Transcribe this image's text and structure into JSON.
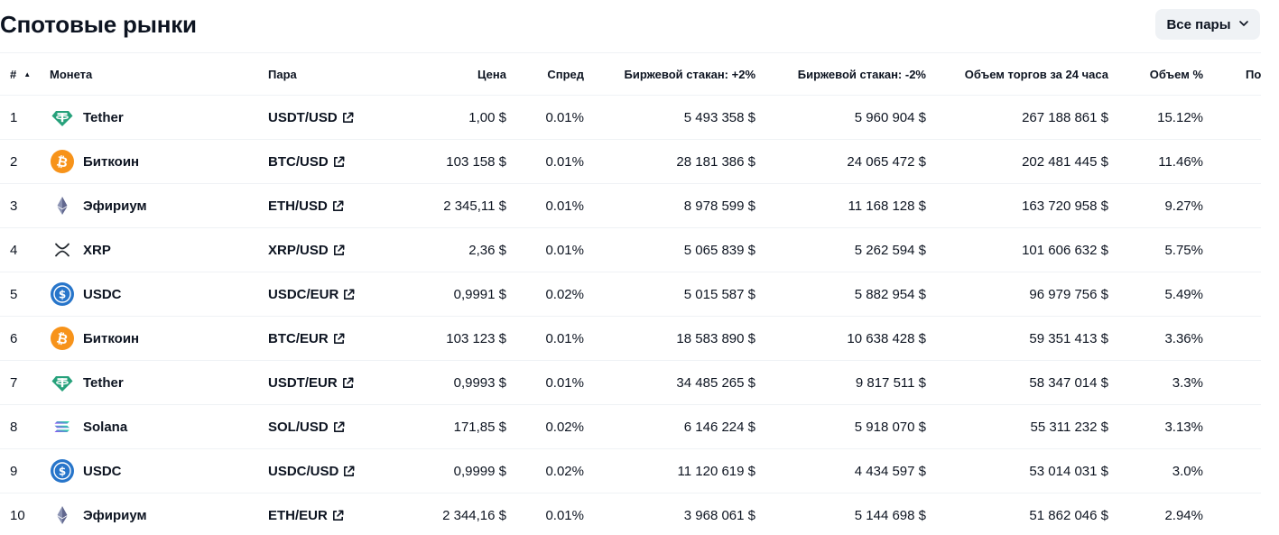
{
  "page": {
    "title": "Спотовые рынки",
    "filter_label": "Все пары"
  },
  "colors": {
    "text": "#0d1421",
    "divider": "#eff2f5",
    "tether": "#26a17b",
    "bitcoin": "#f7931a",
    "usdc": "#2775ca",
    "ethereum": "#627eea"
  },
  "table": {
    "headers": {
      "rank": "#",
      "coin": "Монета",
      "pair": "Пара",
      "price": "Цена",
      "spread": "Спред",
      "depth_plus": "Биржевой стакан: +2%",
      "depth_minus": "Биржевой стакан: -2%",
      "volume_24h": "Объем торгов за 24 часа",
      "volume_pct": "Объем %",
      "last_updated": "Последнее обновление"
    },
    "rows": [
      {
        "rank": "1",
        "coin": "Tether",
        "icon": "tether-icon",
        "pair": "USDT/USD",
        "price": "1,00 $",
        "spread": "0.01%",
        "depth_plus": "5 493 358 $",
        "depth_minus": "5 960 904 $",
        "volume": "267 188 861 $",
        "volume_pct": "15.12%"
      },
      {
        "rank": "2",
        "coin": "Биткоин",
        "icon": "bitcoin-icon",
        "pair": "BTC/USD",
        "price": "103 158 $",
        "spread": "0.01%",
        "depth_plus": "28 181 386 $",
        "depth_minus": "24 065 472 $",
        "volume": "202 481 445 $",
        "volume_pct": "11.46%"
      },
      {
        "rank": "3",
        "coin": "Эфириум",
        "icon": "ethereum-icon",
        "pair": "ETH/USD",
        "price": "2 345,11 $",
        "spread": "0.01%",
        "depth_plus": "8 978 599 $",
        "depth_minus": "11 168 128 $",
        "volume": "163 720 958 $",
        "volume_pct": "9.27%"
      },
      {
        "rank": "4",
        "coin": "XRP",
        "icon": "xrp-icon",
        "pair": "XRP/USD",
        "price": "2,36 $",
        "spread": "0.01%",
        "depth_plus": "5 065 839 $",
        "depth_minus": "5 262 594 $",
        "volume": "101 606 632 $",
        "volume_pct": "5.75%"
      },
      {
        "rank": "5",
        "coin": "USDC",
        "icon": "usdc-icon",
        "pair": "USDC/EUR",
        "price": "0,9991 $",
        "spread": "0.02%",
        "depth_plus": "5 015 587 $",
        "depth_minus": "5 882 954 $",
        "volume": "96 979 756 $",
        "volume_pct": "5.49%"
      },
      {
        "rank": "6",
        "coin": "Биткоин",
        "icon": "bitcoin-icon",
        "pair": "BTC/EUR",
        "price": "103 123 $",
        "spread": "0.01%",
        "depth_plus": "18 583 890 $",
        "depth_minus": "10 638 428 $",
        "volume": "59 351 413 $",
        "volume_pct": "3.36%"
      },
      {
        "rank": "7",
        "coin": "Tether",
        "icon": "tether-icon",
        "pair": "USDT/EUR",
        "price": "0,9993 $",
        "spread": "0.01%",
        "depth_plus": "34 485 265 $",
        "depth_minus": "9 817 511 $",
        "volume": "58 347 014 $",
        "volume_pct": "3.3%"
      },
      {
        "rank": "8",
        "coin": "Solana",
        "icon": "solana-icon",
        "pair": "SOL/USD",
        "price": "171,85 $",
        "spread": "0.02%",
        "depth_plus": "6 146 224 $",
        "depth_minus": "5 918 070 $",
        "volume": "55 311 232 $",
        "volume_pct": "3.13%"
      },
      {
        "rank": "9",
        "coin": "USDC",
        "icon": "usdc-icon",
        "pair": "USDC/USD",
        "price": "0,9999 $",
        "spread": "0.02%",
        "depth_plus": "11 120 619 $",
        "depth_minus": "4 434 597 $",
        "volume": "53 014 031 $",
        "volume_pct": "3.0%"
      },
      {
        "rank": "10",
        "coin": "Эфириум",
        "icon": "ethereum-icon",
        "pair": "ETH/EUR",
        "price": "2 344,16 $",
        "spread": "0.01%",
        "depth_plus": "3 968 061 $",
        "depth_minus": "5 144 698 $",
        "volume": "51 862 046 $",
        "volume_pct": "2.94%"
      }
    ]
  }
}
